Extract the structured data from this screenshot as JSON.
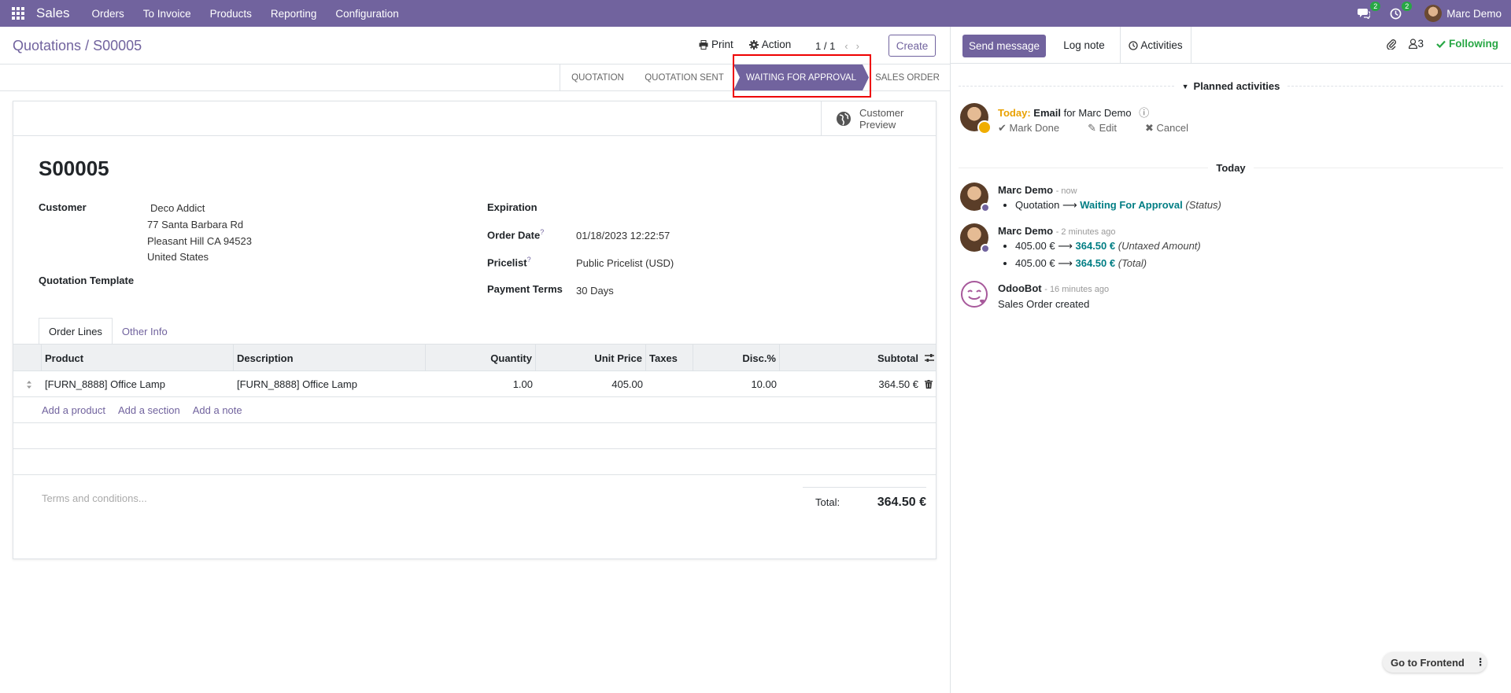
{
  "navbar": {
    "brand": "Sales",
    "menu": [
      "Orders",
      "To Invoice",
      "Products",
      "Reporting",
      "Configuration"
    ],
    "messages_count": "2",
    "activities_count": "2",
    "user_name": "Marc Demo"
  },
  "control": {
    "breadcrumb_parent": "Quotations",
    "breadcrumb_sep": "/",
    "breadcrumb_current": "S00005",
    "print_label": "Print",
    "action_label": "Action",
    "pager": "1 / 1",
    "create_label": "Create"
  },
  "statusbar": {
    "stages": [
      "QUOTATION",
      "QUOTATION SENT",
      "WAITING FOR APPROVAL",
      "SALES ORDER"
    ],
    "active_index": 2
  },
  "form": {
    "customer_preview": [
      "Customer",
      "Preview"
    ],
    "title": "S00005",
    "customer_label": "Customer",
    "customer_name": "Deco Addict",
    "address_line1": "77 Santa Barbara Rd",
    "address_line2": "Pleasant Hill CA 94523",
    "address_line3": "United States",
    "template_label": "Quotation Template",
    "expiration_label": "Expiration",
    "order_date_label": "Order Date",
    "order_date_value": "01/18/2023 12:22:57",
    "pricelist_label": "Pricelist",
    "pricelist_value": "Public Pricelist (USD)",
    "payment_terms_label": "Payment Terms",
    "payment_terms_value": "30 Days",
    "help_mark": "?",
    "tabs": [
      "Order Lines",
      "Other Info"
    ],
    "columns": [
      "Product",
      "Description",
      "Quantity",
      "Unit Price",
      "Taxes",
      "Disc.%",
      "Subtotal"
    ],
    "rows": [
      {
        "product": "[FURN_8888] Office Lamp",
        "description": "[FURN_8888] Office Lamp",
        "quantity": "1.00",
        "unit_price": "405.00",
        "taxes": "",
        "discount": "10.00",
        "subtotal": "364.50 €"
      }
    ],
    "add_links": [
      "Add a product",
      "Add a section",
      "Add a note"
    ],
    "terms_placeholder": "Terms and conditions...",
    "total_label": "Total:",
    "total_value": "364.50 €"
  },
  "chatter": {
    "send_message": "Send message",
    "log_note": "Log note",
    "activities": "Activities",
    "followers_count": "3",
    "following": "Following",
    "planned_label": "Planned activities",
    "activity": {
      "today": "Today:",
      "type": "Email",
      "for": "for Marc Demo",
      "mark_done": "Mark Done",
      "edit": "Edit",
      "cancel": "Cancel"
    },
    "today_label": "Today",
    "messages": [
      {
        "author": "Marc Demo",
        "when": "- now",
        "changes": [
          {
            "from": "Quotation",
            "to": "Waiting For Approval",
            "field": "(Status)"
          }
        ]
      },
      {
        "author": "Marc Demo",
        "when": "- 2 minutes ago",
        "changes": [
          {
            "from": "405.00 €",
            "to": "364.50 €",
            "field": "(Untaxed Amount)"
          },
          {
            "from": "405.00 €",
            "to": "364.50 €",
            "field": "(Total)"
          }
        ]
      },
      {
        "author": "OdooBot",
        "when": "- 16 minutes ago",
        "body": "Sales Order created"
      }
    ],
    "arrow": "⟶"
  },
  "footer": {
    "go_frontend": "Go to Frontend"
  }
}
